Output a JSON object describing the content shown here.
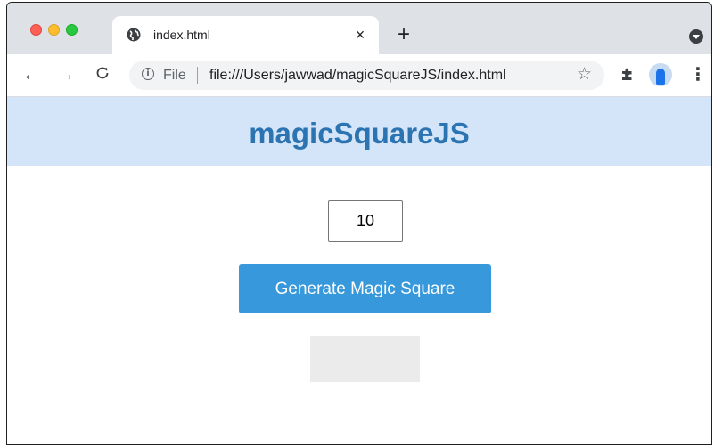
{
  "browser": {
    "tab": {
      "title": "index.html",
      "favicon": "globe-icon",
      "close_symbol": "×"
    },
    "new_tab_symbol": "+",
    "toolbar": {
      "back_symbol": "←",
      "forward_symbol": "→",
      "reload_symbol": "C",
      "address": {
        "scheme_label": "File",
        "url": "file:///Users/jawwad/magicSquareJS/index.html",
        "info_symbol": "i",
        "bookmark_symbol": "☆"
      },
      "menu_symbol": "⋮"
    },
    "colors": {
      "tabstrip_bg": "#dee1e6",
      "omnibox_bg": "#f1f3f4"
    }
  },
  "page": {
    "title": "magicSquareJS",
    "size_input": {
      "value": "10"
    },
    "generate_button_label": "Generate Magic Square",
    "colors": {
      "header_bg": "#d4e5f9",
      "title": "#2b74b1",
      "button_bg": "#3798db",
      "result_bg": "#ebebeb"
    }
  }
}
